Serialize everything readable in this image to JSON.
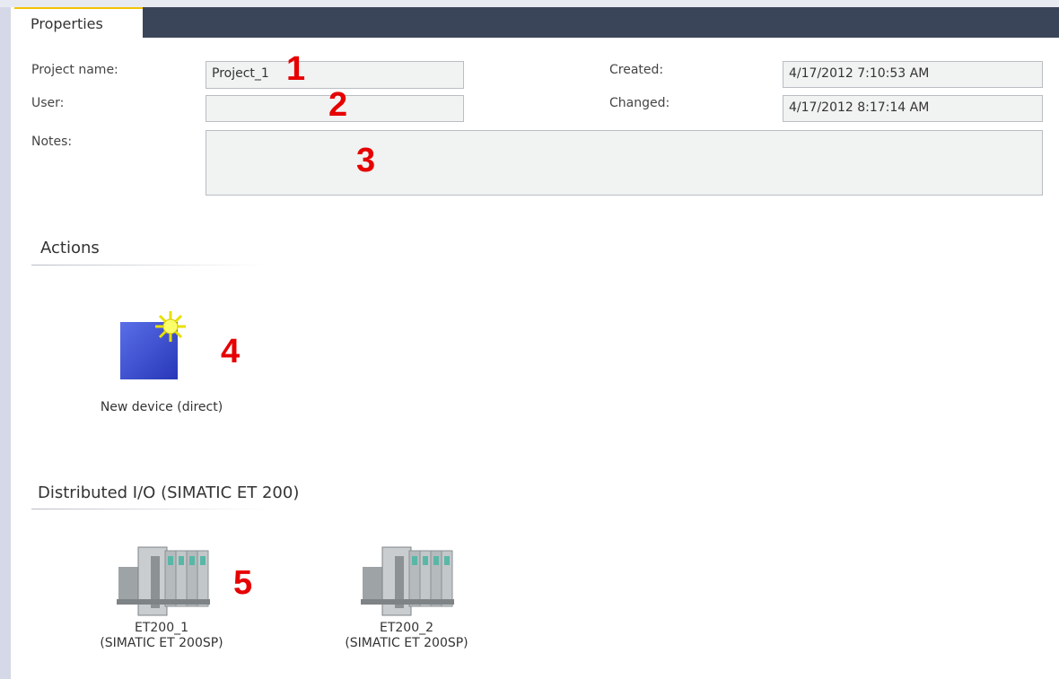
{
  "tab": {
    "label": "Properties"
  },
  "properties": {
    "project_name": {
      "label": "Project name:",
      "value": "Project_1"
    },
    "user": {
      "label": "User:",
      "value": ""
    },
    "notes": {
      "label": "Notes:",
      "value": ""
    },
    "created": {
      "label": "Created:",
      "value": "4/17/2012 7:10:53 AM"
    },
    "changed": {
      "label": "Changed:",
      "value": "4/17/2012 8:17:14 AM"
    }
  },
  "actions": {
    "title": "Actions",
    "new_device": {
      "label": "New device (direct)",
      "icon": "new-device-icon"
    }
  },
  "distributed_io": {
    "title": "Distributed I/O  (SIMATIC ET 200)",
    "devices": [
      {
        "name": "ET200_1",
        "type": "(SIMATIC ET 200SP)",
        "icon": "et200sp-icon"
      },
      {
        "name": "ET200_2",
        "type": "(SIMATIC ET 200SP)",
        "icon": "et200sp-icon"
      }
    ]
  },
  "markers": [
    "1",
    "2",
    "3",
    "4",
    "5"
  ],
  "colors": {
    "header": "#3b4559",
    "tab_accent": "#f2c200",
    "marker": "#e60000",
    "field_bg": "#f1f2f2"
  }
}
